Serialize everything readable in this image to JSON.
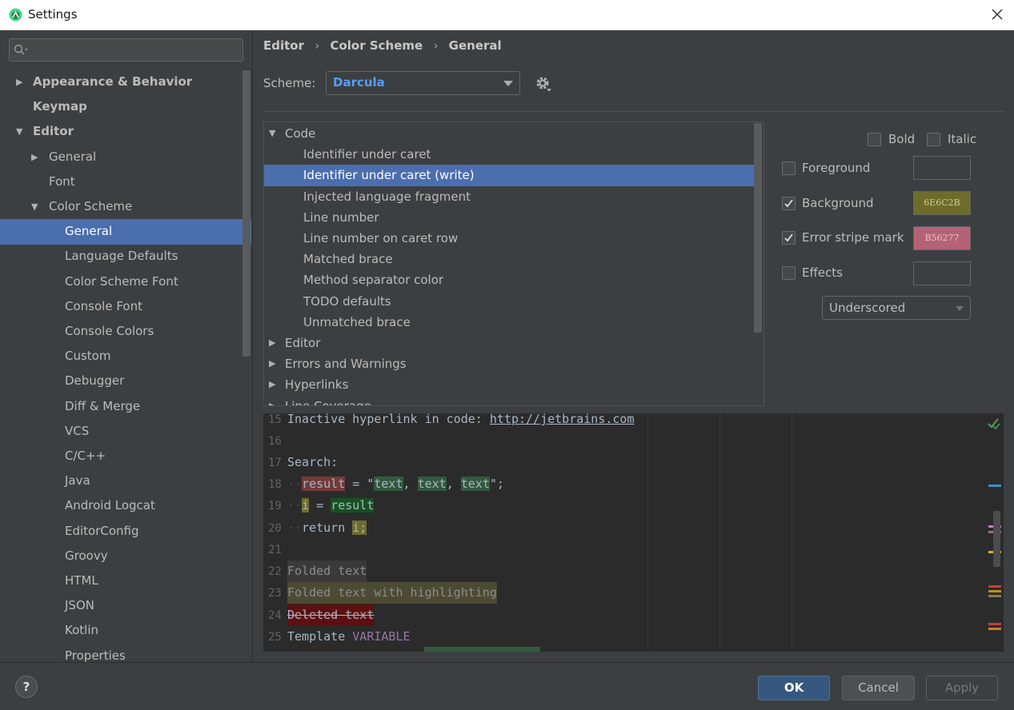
{
  "window": {
    "title": "Settings"
  },
  "sidebar": {
    "search_placeholder": "",
    "items": [
      {
        "label": "Appearance & Behavior",
        "level": 0,
        "arrow": "▶",
        "bold": true
      },
      {
        "label": "Keymap",
        "level": 0,
        "arrow": "",
        "bold": true
      },
      {
        "label": "Editor",
        "level": 0,
        "arrow": "▼",
        "bold": true
      },
      {
        "label": "General",
        "level": 1,
        "arrow": "▶"
      },
      {
        "label": "Font",
        "level": 1,
        "arrow": ""
      },
      {
        "label": "Color Scheme",
        "level": 1,
        "arrow": "▼"
      },
      {
        "label": "General",
        "level": 2,
        "arrow": "",
        "selected": true
      },
      {
        "label": "Language Defaults",
        "level": 2,
        "arrow": ""
      },
      {
        "label": "Color Scheme Font",
        "level": 2,
        "arrow": ""
      },
      {
        "label": "Console Font",
        "level": 2,
        "arrow": ""
      },
      {
        "label": "Console Colors",
        "level": 2,
        "arrow": ""
      },
      {
        "label": "Custom",
        "level": 2,
        "arrow": ""
      },
      {
        "label": "Debugger",
        "level": 2,
        "arrow": ""
      },
      {
        "label": "Diff & Merge",
        "level": 2,
        "arrow": ""
      },
      {
        "label": "VCS",
        "level": 2,
        "arrow": ""
      },
      {
        "label": "C/C++",
        "level": 2,
        "arrow": ""
      },
      {
        "label": "Java",
        "level": 2,
        "arrow": ""
      },
      {
        "label": "Android Logcat",
        "level": 2,
        "arrow": ""
      },
      {
        "label": "EditorConfig",
        "level": 2,
        "arrow": ""
      },
      {
        "label": "Groovy",
        "level": 2,
        "arrow": ""
      },
      {
        "label": "HTML",
        "level": 2,
        "arrow": ""
      },
      {
        "label": "JSON",
        "level": 2,
        "arrow": ""
      },
      {
        "label": "Kotlin",
        "level": 2,
        "arrow": ""
      },
      {
        "label": "Properties",
        "level": 2,
        "arrow": ""
      }
    ]
  },
  "breadcrumb": {
    "part1": "Editor",
    "part2": "Color Scheme",
    "part3": "General",
    "sep": "›"
  },
  "scheme": {
    "label": "Scheme:",
    "value": "Darcula"
  },
  "color_tree": [
    {
      "label": "Code",
      "level": 0,
      "arrow": "▼"
    },
    {
      "label": "Identifier under caret",
      "level": 1
    },
    {
      "label": "Identifier under caret (write)",
      "level": 1,
      "selected": true
    },
    {
      "label": "Injected language fragment",
      "level": 1
    },
    {
      "label": "Line number",
      "level": 1
    },
    {
      "label": "Line number on caret row",
      "level": 1
    },
    {
      "label": "Matched brace",
      "level": 1
    },
    {
      "label": "Method separator color",
      "level": 1
    },
    {
      "label": "TODO defaults",
      "level": 1
    },
    {
      "label": "Unmatched brace",
      "level": 1
    },
    {
      "label": "Editor",
      "level": 0,
      "arrow": "▶"
    },
    {
      "label": "Errors and Warnings",
      "level": 0,
      "arrow": "▶"
    },
    {
      "label": "Hyperlinks",
      "level": 0,
      "arrow": "▶"
    },
    {
      "label": "Line Coverage",
      "level": 0,
      "arrow": "▶"
    }
  ],
  "props": {
    "bold": {
      "label": "Bold",
      "checked": false
    },
    "italic": {
      "label": "Italic",
      "checked": false
    },
    "foreground": {
      "label": "Foreground",
      "checked": false,
      "color": ""
    },
    "background": {
      "label": "Background",
      "checked": true,
      "color": "6E6C2B",
      "hex": "#6e6c2b"
    },
    "error_stripe": {
      "label": "Error stripe mark",
      "checked": true,
      "color": "B56277",
      "hex": "#b56277"
    },
    "effects": {
      "label": "Effects",
      "checked": false,
      "color": ""
    },
    "effect_type": "Underscored"
  },
  "preview": {
    "numbers": [
      "15",
      "16",
      "17",
      "18",
      "19",
      "20",
      "21",
      "22",
      "23",
      "24",
      "25"
    ],
    "line15": {
      "text": "Inactive hyperlink in code: ",
      "link": "http://jetbrains.com"
    },
    "line17": "Search:",
    "line18": {
      "a": "result",
      "b": " = \"",
      "t1": "text",
      "c": ", ",
      "t2": "text",
      "d": ", ",
      "t3": "text",
      "e": "\";"
    },
    "line19": {
      "a": "i",
      "b": " = ",
      "c": "result"
    },
    "line20": {
      "a": "return ",
      "b": "i;"
    },
    "line22": "Folded text",
    "line23": "Folded text with highlighting",
    "line24": "Deleted text",
    "line25": {
      "a": "Template ",
      "b": "VARIABLE"
    }
  },
  "footer": {
    "help": "?",
    "ok": "OK",
    "cancel": "Cancel",
    "apply": "Apply"
  }
}
